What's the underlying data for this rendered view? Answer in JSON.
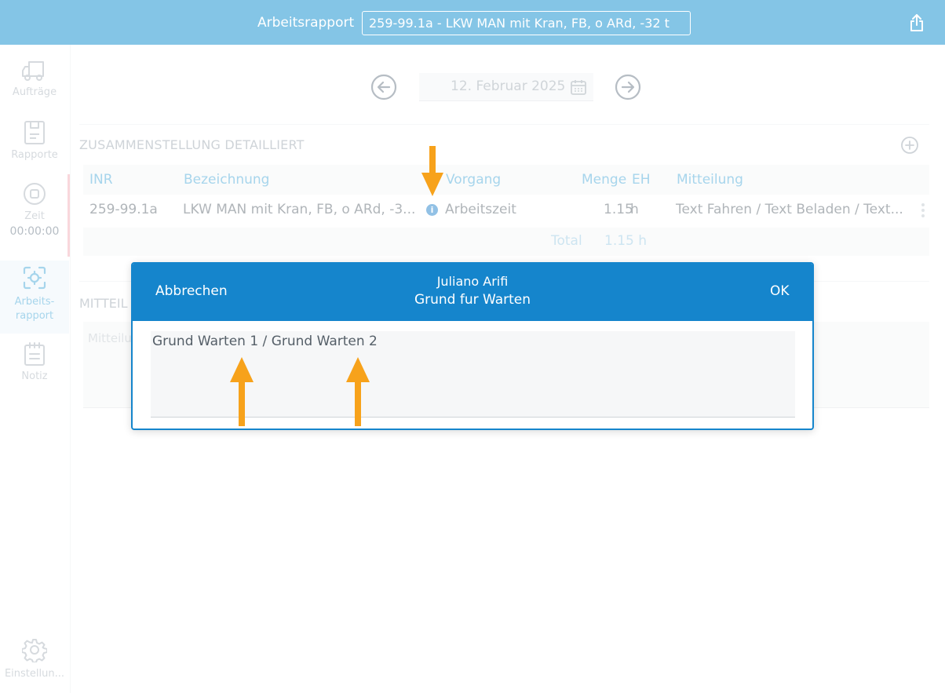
{
  "topbar": {
    "title": "Arbeitsrapport",
    "field_value": "259-99.1a - LKW MAN mit Kran, FB, o ARd, -32 t",
    "share_icon": "share-icon"
  },
  "sidebar": {
    "items": [
      {
        "label": "Aufträge",
        "icon": "truck-icon"
      },
      {
        "label": "Rapporte",
        "icon": "document-icon"
      },
      {
        "label": "Zeit",
        "icon": "stop-timer-icon",
        "time": "00:00:00"
      },
      {
        "label": "Arbeits-",
        "label2": "rapport",
        "icon": "scan-target-icon"
      },
      {
        "label": "Notiz",
        "icon": "notepad-icon"
      },
      {
        "label": "Einstellun...",
        "icon": "gear-icon"
      }
    ]
  },
  "datenav": {
    "date": "12. Februar 2025"
  },
  "section": {
    "title": "ZUSAMMENSTELLUNG DETAILLIERT"
  },
  "table": {
    "headers": [
      "INR",
      "Bezeichnung",
      "Vorgang",
      "Menge",
      "EH",
      "Mitteilung"
    ],
    "row": {
      "inr": "259-99.1a",
      "bezeichnung": "LKW MAN mit Kran, FB, o ARd, -3...",
      "vorgang": "Arbeitszeit",
      "menge": "1.15",
      "eh": "h",
      "mitteilung": "Text Fahren / Text Beladen / Text..."
    },
    "total_label": "Total",
    "total_value": "1.15 h"
  },
  "mitteilung": {
    "label": "MITTEIL",
    "placeholder": "Mitteilu"
  },
  "modal": {
    "cancel_label": "Abbrechen",
    "ok_label": "OK",
    "title_line1": "Juliano Arifi",
    "title_line2": "Grund fur Warten",
    "text_value": "Grund Warten 1 / Grund Warten 2"
  },
  "colors": {
    "topbar": "#84c5e6",
    "accent": "#5eb2dc",
    "modal_header": "#1585cc",
    "arrow": "#f7a21b"
  }
}
